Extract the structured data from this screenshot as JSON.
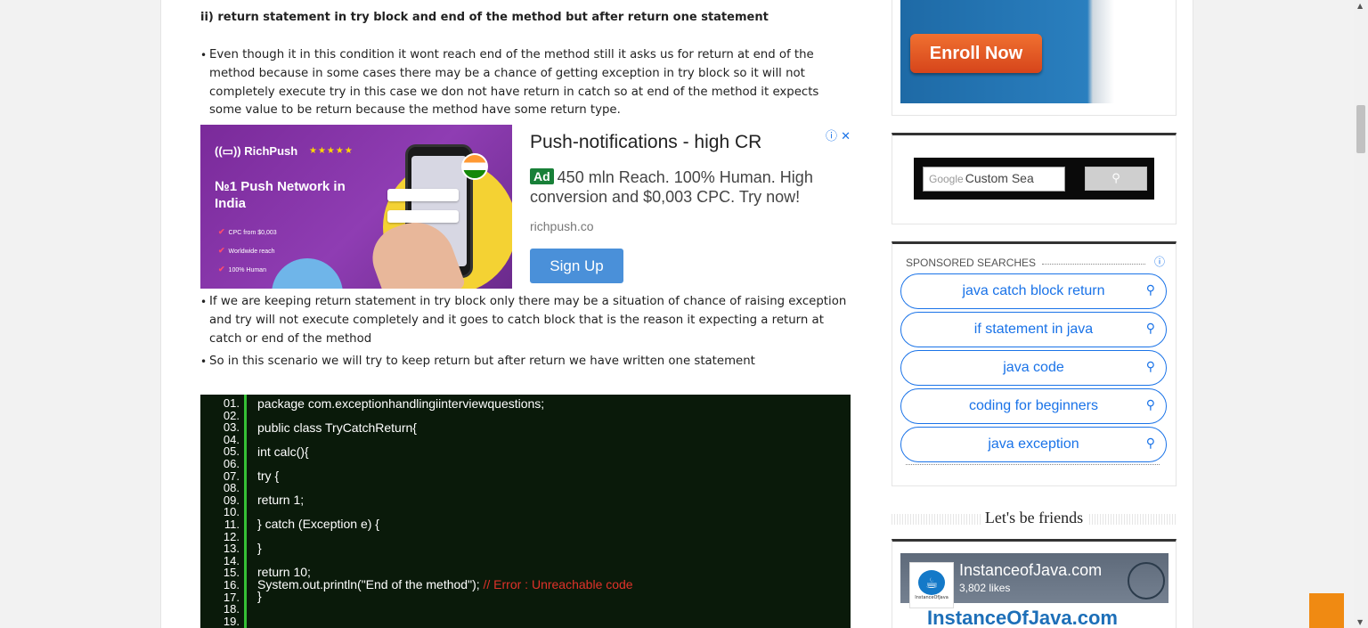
{
  "article": {
    "heading": "ii) return statement in try block and end of the method but after return one statement",
    "bullets": [
      "Even though it in this condition it wont reach end of the method still it asks us for return at end of the method because in some cases there may be a chance of getting exception in try block so it will not completely execute try in this case we don not have return in catch so at end of the method it expects some value to be return because the  method have some return type.",
      "If we are keeping return statement in try block only there may be a situation of chance of raising exception and try will not execute completely and it goes to catch block that is the reason it expecting a return at catch or end of the method",
      "So in this scenario we will try to keep return but after return we have written one statement"
    ]
  },
  "ad": {
    "brand": "RichPush",
    "stars": "★★★★★",
    "image_headline": "№1 Push Network in India",
    "image_features": [
      "CPC from $0,003",
      "Worldwide reach",
      "100% Human"
    ],
    "title": "Push-notifications - high CR",
    "badge": "Ad",
    "description": "450 mln Reach. 100% Human. High conversion and $0,003 CPC. Try now!",
    "url": "richpush.co",
    "button": "Sign Up",
    "choices_icon": "ⓘ ✕"
  },
  "code": {
    "line_numbers": [
      "01.",
      "02.",
      "03.",
      "04.",
      "05.",
      "06.",
      "07.",
      "08.",
      "09.",
      "10.",
      "11.",
      "12.",
      "13.",
      "14.",
      "15.",
      "16.",
      "17.",
      "18.",
      "19."
    ],
    "lines": [
      "package com.exceptionhandlingiinterviewquestions;",
      "public class TryCatchReturn{",
      "int calc(){",
      "try {",
      "return 1;",
      "} catch (Exception e) {",
      "}",
      "return 10;",
      " System.out.println(\"End of the method\");",
      "}"
    ],
    "error_comment": "// Error : Unreachable code"
  },
  "sidebar": {
    "enroll_button": "Enroll Now",
    "search": {
      "google_label": "Google",
      "placeholder": "Custom Sea",
      "button_icon": "search-icon"
    },
    "sponsored": {
      "title": "SPONSORED SEARCHES",
      "info_icon": "ⓘ",
      "items": [
        "java catch block return",
        "if statement in java",
        "java code",
        "coding for beginners",
        "java exception"
      ]
    },
    "friends_title": "Let's be friends",
    "facebook": {
      "page_name": "InstanceofJava.com",
      "likes": "3,802 likes",
      "logo_caption": "InstanceOfJava",
      "banner_text": "InstanceOfJava.com"
    }
  },
  "colors": {
    "accent_blue": "#1a73e8",
    "code_bg": "#0a1a0a",
    "code_border": "#35c135",
    "error_red": "#e0322a",
    "enroll_orange": "#e2581f",
    "to_top_orange": "#f08a12"
  }
}
